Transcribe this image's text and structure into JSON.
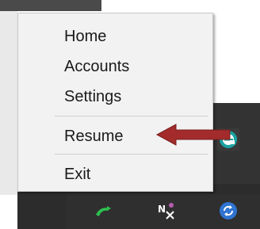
{
  "menu": {
    "items": [
      {
        "id": "home",
        "label": "Home"
      },
      {
        "id": "accounts",
        "label": "Accounts"
      },
      {
        "id": "settings",
        "label": "Settings"
      },
      {
        "id": "resume",
        "label": "Resume"
      },
      {
        "id": "exit",
        "label": "Exit"
      }
    ]
  },
  "tray": {
    "icons": [
      {
        "name": "phone-green-icon",
        "color": "#2ebf4f"
      },
      {
        "name": "onenote-icon",
        "color": "#80397b"
      },
      {
        "name": "sync-icon",
        "color": "#2f74d0"
      }
    ]
  },
  "arrow": {
    "color": "#a32b2b"
  },
  "app_icon": {
    "name": "e-app-icon",
    "color": "#1aa3a3"
  }
}
